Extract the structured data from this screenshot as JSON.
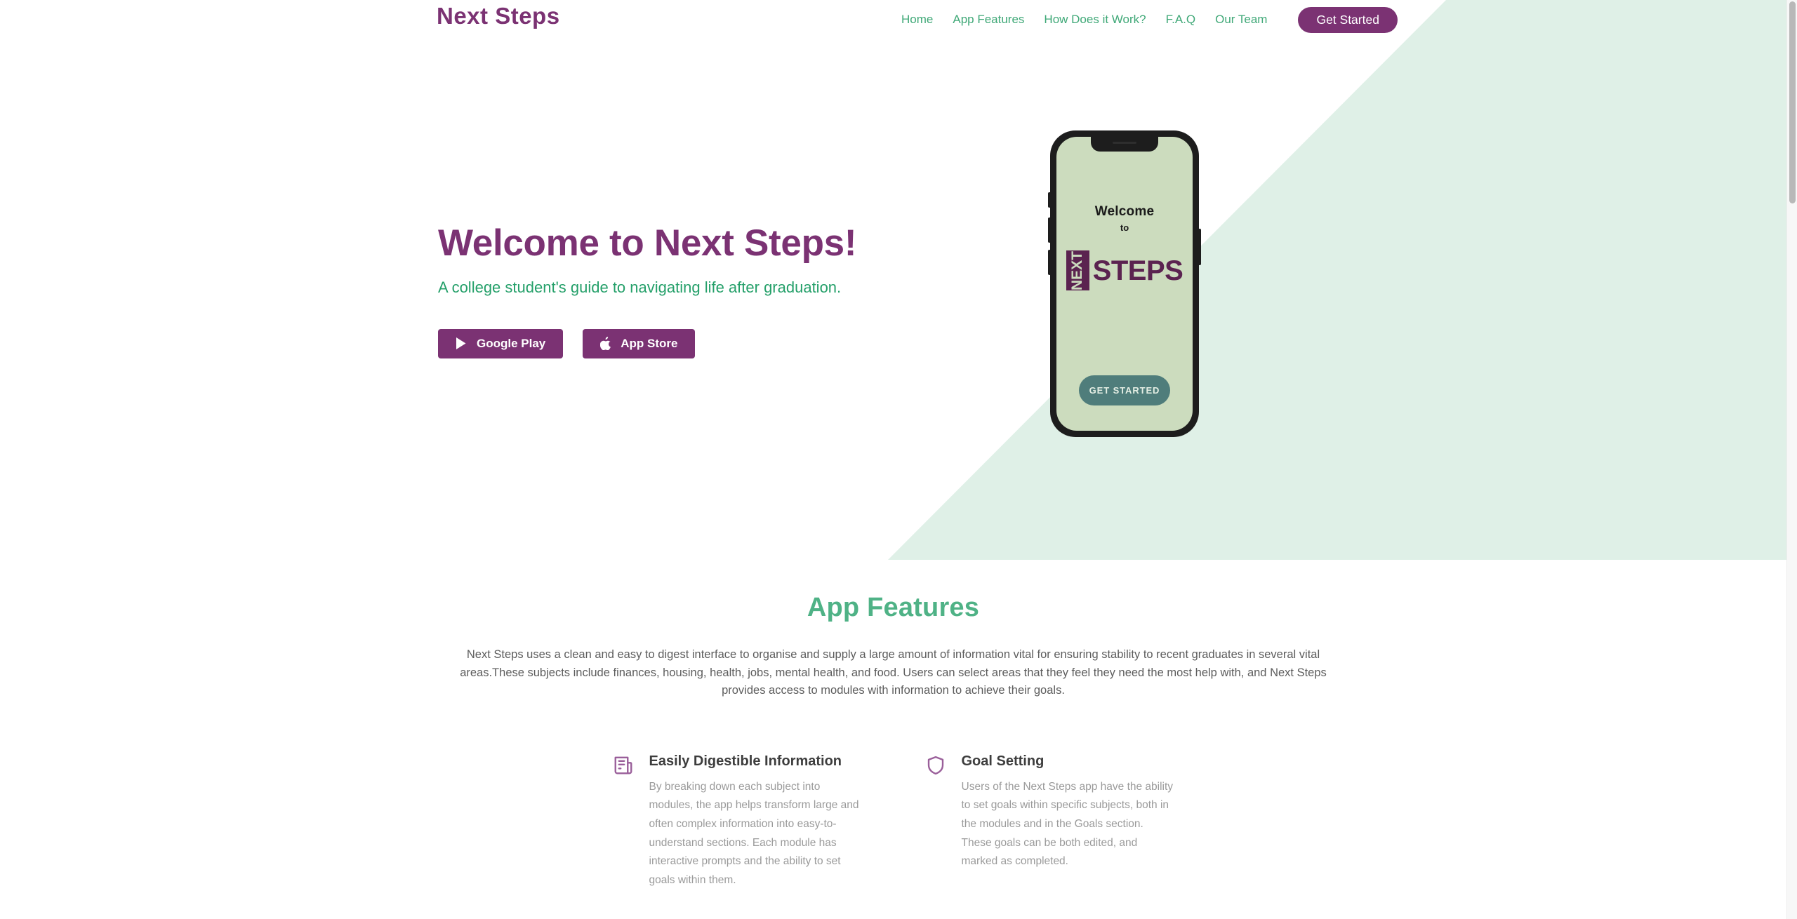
{
  "colors": {
    "purple": "#7B3273",
    "purple_dark": "#5B2350",
    "green_accent": "#4FB286",
    "green_link": "#3FA877",
    "mint_bg": "#DFF0E7",
    "phone_screen": "#CCDCBE",
    "teal_button": "#4F7D7B",
    "body_text": "#5c5c5c",
    "muted_text": "#9a9a9a"
  },
  "navbar": {
    "brand": "Next Steps",
    "links": [
      {
        "label": "Home"
      },
      {
        "label": "App Features"
      },
      {
        "label": "How Does it Work?"
      },
      {
        "label": "F.A.Q"
      },
      {
        "label": "Our Team"
      }
    ],
    "cta_label": "Get Started"
  },
  "hero": {
    "title": "Welcome to Next Steps!",
    "subtitle": "A college student's guide to navigating life after graduation.",
    "buttons": [
      {
        "label": "Google Play",
        "icon": "google-play-icon"
      },
      {
        "label": "App Store",
        "icon": "apple-icon"
      }
    ]
  },
  "phone": {
    "welcome": "Welcome",
    "to": "to",
    "logo_next": "NEXT",
    "logo_steps": "STEPS",
    "cta_label": "GET STARTED"
  },
  "features": {
    "title": "App Features",
    "intro": "Next Steps uses a clean and easy to digest interface to organise and supply a large amount of information vital for ensuring stability to recent graduates in several vital areas.These subjects include finances, housing, health, jobs, mental health, and food. Users can select areas that they feel they need the most help with, and Next Steps provides access to modules with information to achieve their goals.",
    "cards": [
      {
        "icon": "newspaper-icon",
        "title": "Easily Digestible Information",
        "body": "By breaking down each subject into modules, the app helps transform large and often complex information into easy-to-understand sections. Each module has interactive prompts and the ability to set goals within them."
      },
      {
        "icon": "shield-icon",
        "title": "Goal Setting",
        "body": "Users of the Next Steps app have the ability to set goals within specific subjects, both in the modules and in the Goals section. These goals can be both edited, and marked as completed."
      }
    ]
  },
  "browser": {
    "scrollbar_present": true
  }
}
